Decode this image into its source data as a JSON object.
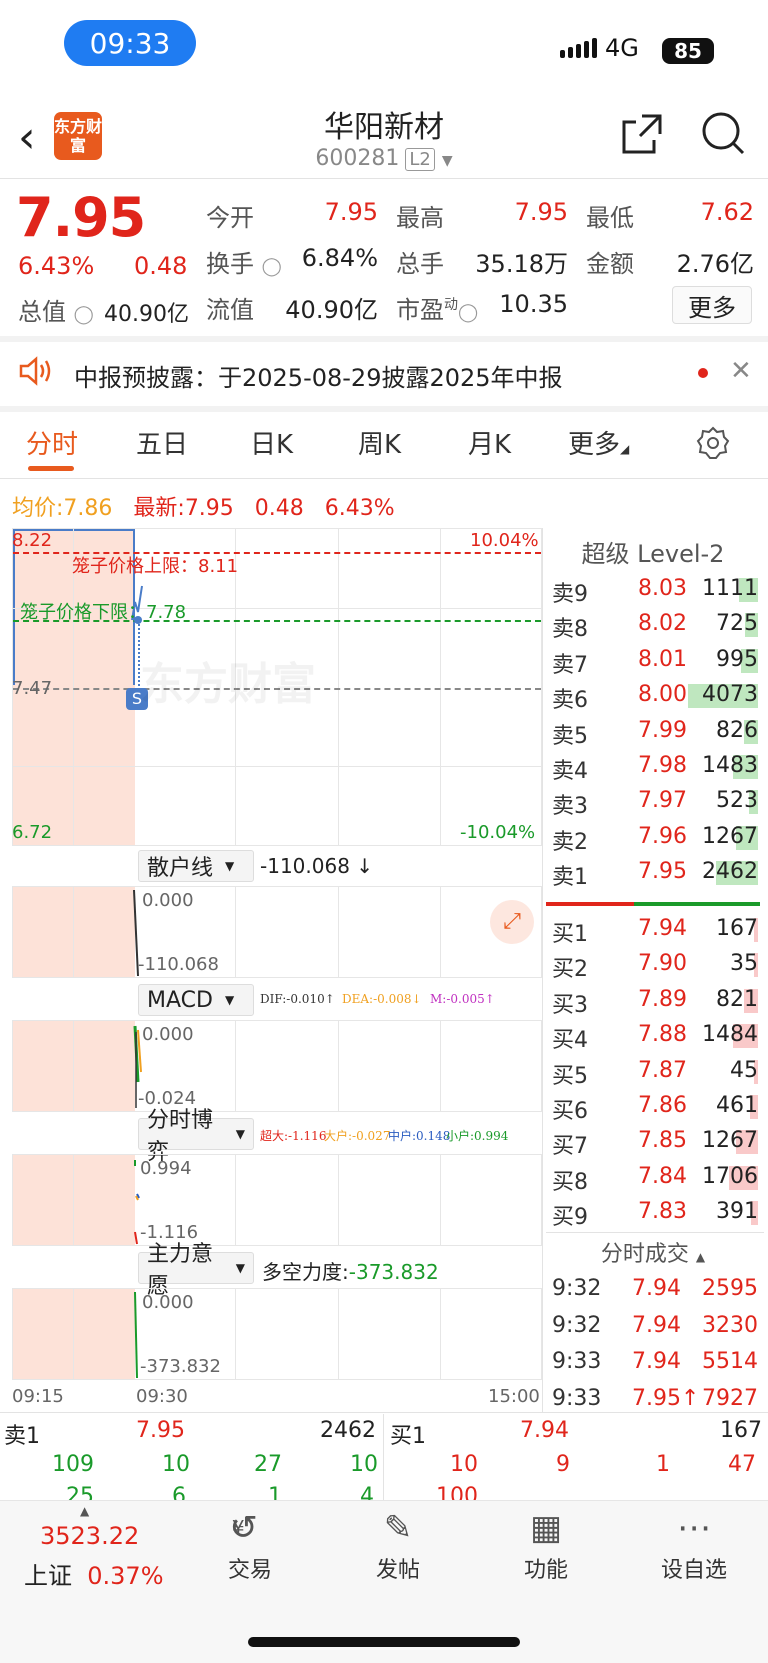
{
  "status": {
    "time": "09:33",
    "network": "4G",
    "battery": "85"
  },
  "header": {
    "name": "华阳新材",
    "code": "600281",
    "level": "L2",
    "logo": "东方财富"
  },
  "quote": {
    "price": "7.95",
    "pct": "6.43%",
    "chg": "0.48",
    "zz_label": "总值",
    "zz_value": "40.90亿",
    "open_label": "今开",
    "open": "7.95",
    "high_label": "最高",
    "high": "7.95",
    "low_label": "最低",
    "low": "7.62",
    "turn_label": "换手",
    "turn": "6.84%",
    "vol_label": "总手",
    "vol": "35.18万",
    "amt_label": "金额",
    "amt": "2.76亿",
    "float_label": "流值",
    "float": "40.90亿",
    "pe_label": "市盈",
    "pe_sup": "动",
    "pe": "10.35",
    "more": "更多"
  },
  "notice": {
    "text": "中报预披露：于2025-08-29披露2025年中报"
  },
  "tabs": [
    "分时",
    "五日",
    "日K",
    "周K",
    "月K",
    "更多"
  ],
  "info": {
    "avg_label": "均价:",
    "avg": "7.86",
    "latest_label": "最新:",
    "latest": "7.95",
    "chg": "0.48",
    "pct": "6.43%"
  },
  "chart": {
    "y_high": "8.22",
    "y_mid": "7.47",
    "y_low": "6.72",
    "pct_high": "10.04%",
    "pct_low": "-10.04%",
    "cage_upper": "笼子价格上限：8.11",
    "cage_lower": "笼子价格下限：7.78",
    "t_start": "09:15",
    "t_open": "09:30",
    "t_end": "15:00",
    "watermark": "东方财富"
  },
  "indicators": {
    "sanhu": {
      "name": "散户线",
      "value": "-110.068 ↓",
      "top": "0.000",
      "bottom": "-110.068"
    },
    "macd": {
      "name": "MACD",
      "dif": "DIF:-0.010↑",
      "dea": "DEA:-0.008↓",
      "m": "M:-0.005↑",
      "top": "0.000",
      "bottom": "-0.024"
    },
    "boyi": {
      "name": "分时博弈",
      "chaoda": "超大:-1.116",
      "dahu": "大户:-0.027",
      "zhonghu": "中户:0.148",
      "xiaohu": "小户:0.994",
      "top": "0.994",
      "bottom": "-1.116"
    },
    "zhuli": {
      "name": "主力意愿",
      "label": "多空力度:",
      "value": "-373.832",
      "top": "0.000",
      "bottom": "-373.832"
    }
  },
  "orderbook": {
    "title": "超级 Level-2",
    "asks": [
      {
        "label": "卖9",
        "price": "8.03",
        "vol": "1111",
        "frac": 0.27
      },
      {
        "label": "卖8",
        "price": "8.02",
        "vol": "725",
        "frac": 0.18
      },
      {
        "label": "卖7",
        "price": "8.01",
        "vol": "995",
        "frac": 0.24
      },
      {
        "label": "卖6",
        "price": "8.00",
        "vol": "4073",
        "frac": 1.0
      },
      {
        "label": "卖5",
        "price": "7.99",
        "vol": "826",
        "frac": 0.2
      },
      {
        "label": "卖4",
        "price": "7.98",
        "vol": "1483",
        "frac": 0.36
      },
      {
        "label": "卖3",
        "price": "7.97",
        "vol": "523",
        "frac": 0.13
      },
      {
        "label": "卖2",
        "price": "7.96",
        "vol": "1267",
        "frac": 0.31
      },
      {
        "label": "卖1",
        "price": "7.95",
        "vol": "2462",
        "frac": 0.6
      }
    ],
    "bids": [
      {
        "label": "买1",
        "price": "7.94",
        "vol": "167",
        "frac": 0.04
      },
      {
        "label": "买2",
        "price": "7.90",
        "vol": "35",
        "frac": 0.01
      },
      {
        "label": "买3",
        "price": "7.89",
        "vol": "821",
        "frac": 0.2
      },
      {
        "label": "买4",
        "price": "7.88",
        "vol": "1484",
        "frac": 0.36
      },
      {
        "label": "买5",
        "price": "7.87",
        "vol": "45",
        "frac": 0.01
      },
      {
        "label": "买6",
        "price": "7.86",
        "vol": "461",
        "frac": 0.11
      },
      {
        "label": "买7",
        "price": "7.85",
        "vol": "1267",
        "frac": 0.31
      },
      {
        "label": "买8",
        "price": "7.84",
        "vol": "1706",
        "frac": 0.42
      },
      {
        "label": "买9",
        "price": "7.83",
        "vol": "391",
        "frac": 0.1
      }
    ],
    "trades_title": "分时成交",
    "trades": [
      {
        "t": "9:32",
        "p": "7.94",
        "v": "2595"
      },
      {
        "t": "9:32",
        "p": "7.94",
        "v": "3230"
      },
      {
        "t": "9:33",
        "p": "7.94",
        "v": "5514"
      },
      {
        "t": "9:33",
        "p": "7.95↑",
        "v": "7927"
      }
    ]
  },
  "detail": {
    "sell_label": "卖1",
    "sell_price": "7.95",
    "sell_vol": "2462",
    "buy_label": "买1",
    "buy_price": "7.94",
    "buy_vol": "167",
    "sell_row1": [
      "109",
      "10",
      "27",
      "10"
    ],
    "sell_row2": [
      "25",
      "6",
      "1",
      "4"
    ],
    "buy_row1": [
      "10",
      "9",
      "1",
      "47"
    ],
    "buy_row2": [
      "100"
    ]
  },
  "bottom_nav": {
    "index_value": "3523.22",
    "index_name": "上证",
    "index_pct": "0.37%",
    "items": [
      "交易",
      "发帖",
      "功能",
      "设自选"
    ]
  }
}
